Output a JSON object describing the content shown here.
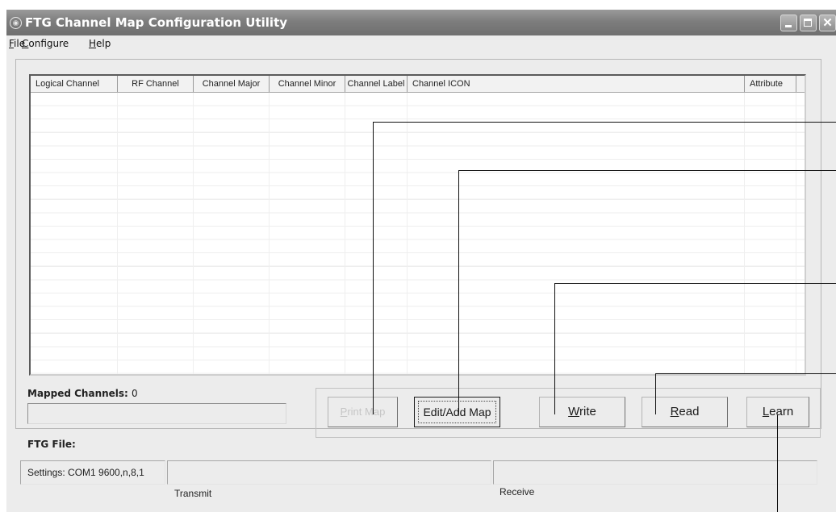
{
  "window": {
    "title": "FTG Channel Map Configuration Utility",
    "controls": [
      "minimize",
      "maximize",
      "close"
    ]
  },
  "menu": [
    {
      "label": "File",
      "accel": "F",
      "rest": "ile"
    },
    {
      "label": "Configure",
      "accel": "C",
      "rest": "onfigure"
    },
    {
      "label": "Help",
      "accel": "H",
      "rest": "elp"
    }
  ],
  "table": {
    "columns": [
      "Logical Channel",
      "RF Channel",
      "Channel Major",
      "Channel Minor",
      "Channel Label",
      "Channel ICON",
      "Attribute"
    ],
    "rows": []
  },
  "mapped_channels": {
    "label": "Mapped Channels:",
    "value": "0"
  },
  "ftg_file": {
    "label": "FTG File:",
    "value": ""
  },
  "buttons": {
    "print_map": {
      "label": "Print Map",
      "accel": "P",
      "rest": "rint Map",
      "enabled": false
    },
    "edit_add_map": {
      "label": "Edit/Add Map",
      "enabled": true
    },
    "write": {
      "label": "Write",
      "accel": "W",
      "rest": "rite",
      "enabled": true
    },
    "read": {
      "label": "Read",
      "accel": "R",
      "rest": "ead",
      "enabled": true
    },
    "learn": {
      "label": "Learn",
      "accel": "L",
      "rest": "earn",
      "enabled": true
    }
  },
  "status": {
    "settings": "Settings: COM1 9600,n,8,1",
    "transmit_label": "Transmit",
    "receive_label": "Receive"
  }
}
